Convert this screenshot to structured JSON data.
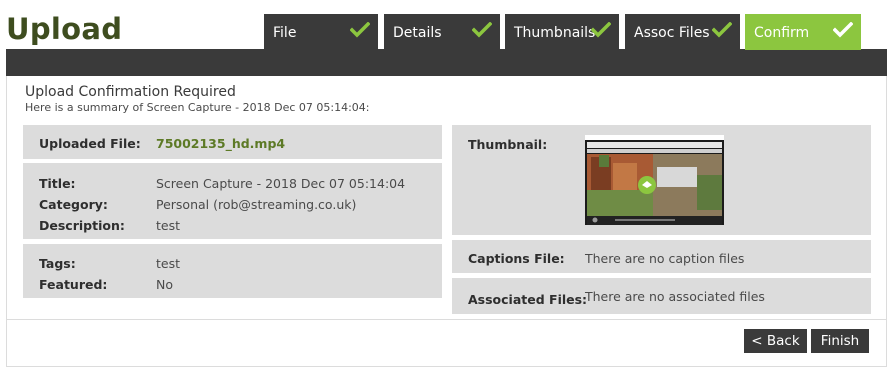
{
  "header": {
    "title": "Upload"
  },
  "steps": [
    {
      "label": "File",
      "state": "complete",
      "icon": "check-icon"
    },
    {
      "label": "Details",
      "state": "complete",
      "icon": "check-icon"
    },
    {
      "label": "Thumbnails",
      "state": "complete",
      "icon": "check-icon"
    },
    {
      "label": "Assoc Files",
      "state": "complete",
      "icon": "check-icon"
    },
    {
      "label": "Confirm",
      "state": "active",
      "icon": "check-icon"
    }
  ],
  "summary": {
    "title": "Upload Confirmation Required",
    "subtitle": "Here is a summary of Screen Capture - 2018 Dec 07 05:14:04:"
  },
  "uploaded_file": {
    "label": "Uploaded File:",
    "value": "75002135_hd.mp4"
  },
  "details": {
    "title_label": "Title:",
    "title_value": "Screen Capture - 2018 Dec 07 05:14:04",
    "category_label": "Category:",
    "category_value": "Personal (rob@streaming.co.uk)",
    "description_label": "Description:",
    "description_value": "test"
  },
  "tags": {
    "tags_label": "Tags:",
    "tags_value": "test",
    "featured_label": "Featured:",
    "featured_value": "No"
  },
  "thumbnail": {
    "label": "Thumbnail:"
  },
  "captions": {
    "label": "Captions File:",
    "value": "There are no caption files"
  },
  "associated": {
    "label": "Associated Files:",
    "value": "There are no associated files"
  },
  "buttons": {
    "back": "< Back",
    "finish": "Finish"
  },
  "colors": {
    "accent": "#8cc63f",
    "dark": "#3a3a3a",
    "panel": "#dcdcdc",
    "title": "#3e4d1f",
    "link": "#5d7a26"
  }
}
